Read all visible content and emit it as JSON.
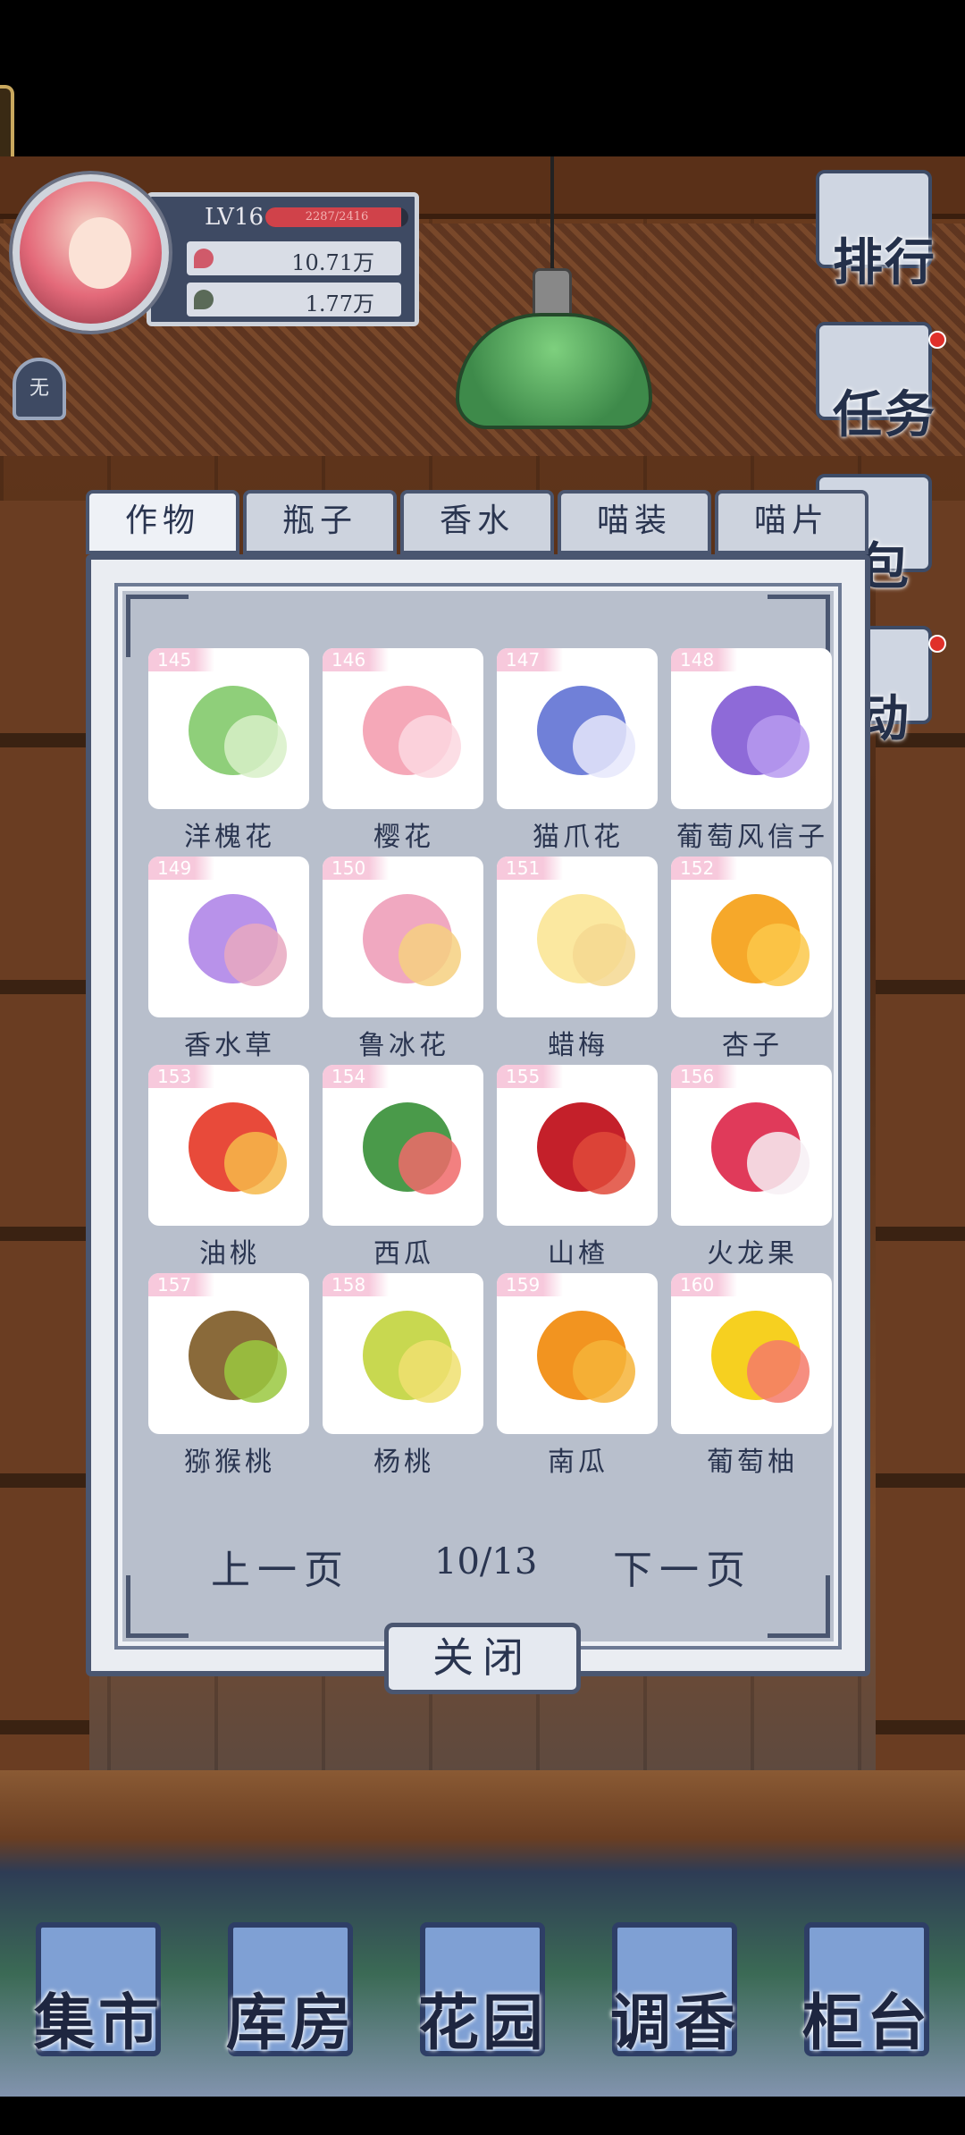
{
  "player": {
    "level": "LV16",
    "exp_text": "2287/2416",
    "exp_fraction": 0.947,
    "money": "10.71万",
    "gems": "1.77万",
    "badge": "无"
  },
  "side_buttons": {
    "rank": "排行",
    "task": "任务",
    "bag": "包",
    "event": "动"
  },
  "codex": {
    "tabs": [
      "作物",
      "瓶子",
      "香水",
      "喵装",
      "喵片"
    ],
    "active_tab": 0,
    "items": [
      {
        "num": "145",
        "name": "洋槐花",
        "color": "#8fcf7a",
        "color2": "#d8f0c8"
      },
      {
        "num": "146",
        "name": "樱花",
        "color": "#f5a8b8",
        "color2": "#fcd8e0"
      },
      {
        "num": "147",
        "name": "猫爪花",
        "color": "#7080d8",
        "color2": "#e6e8fb"
      },
      {
        "num": "148",
        "name": "葡萄风信子",
        "color": "#8e6ad8",
        "color2": "#b79af0"
      },
      {
        "num": "149",
        "name": "香水草",
        "color": "#b892ea",
        "color2": "#e7a8c0"
      },
      {
        "num": "150",
        "name": "鲁冰花",
        "color": "#f0a8c0",
        "color2": "#f6d080"
      },
      {
        "num": "151",
        "name": "蜡梅",
        "color": "#fbe8a0",
        "color2": "#f5d890"
      },
      {
        "num": "152",
        "name": "杏子",
        "color": "#f6a82a",
        "color2": "#fbc84a"
      },
      {
        "num": "153",
        "name": "油桃",
        "color": "#e84a3a",
        "color2": "#f6b84a"
      },
      {
        "num": "154",
        "name": "西瓜",
        "color": "#4a9a4a",
        "color2": "#f06a6a"
      },
      {
        "num": "155",
        "name": "山楂",
        "color": "#c4202a",
        "color2": "#e04a3a"
      },
      {
        "num": "156",
        "name": "火龙果",
        "color": "#e03a5a",
        "color2": "#f7f0f4"
      },
      {
        "num": "157",
        "name": "猕猴桃",
        "color": "#8a6a3a",
        "color2": "#9ac840"
      },
      {
        "num": "158",
        "name": "杨桃",
        "color": "#c8d850",
        "color2": "#f0e070"
      },
      {
        "num": "159",
        "name": "南瓜",
        "color": "#f29420",
        "color2": "#f6b43a"
      },
      {
        "num": "160",
        "name": "葡萄柚",
        "color": "#f6d020",
        "color2": "#f47a6a"
      }
    ],
    "prev_page": "上一页",
    "page": "10/13",
    "next_page": "下一页",
    "close": "关闭"
  },
  "bottom_nav": [
    "集市",
    "库房",
    "花园",
    "调香",
    "柜台"
  ],
  "colors": {
    "frame": "#4a5670",
    "panel": "#b8bfcc",
    "tag_pink": "#f7c9dc",
    "text_dark": "#2a3550"
  }
}
